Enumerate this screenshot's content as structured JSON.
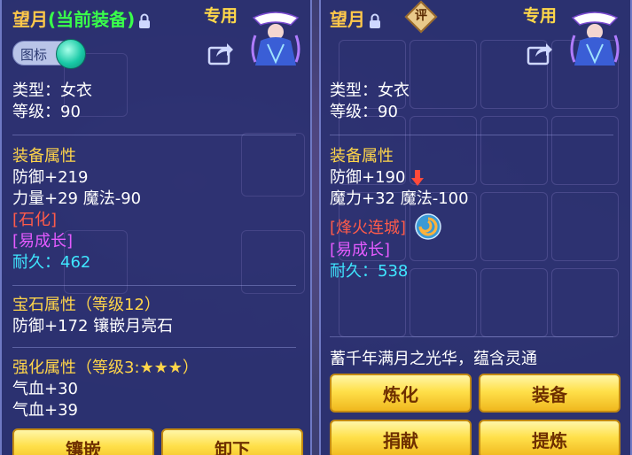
{
  "left_panel": {
    "name": "望月",
    "equipped_tag": "(当前装备)",
    "special_badge": "专用",
    "toggle_label": "图标",
    "type_line": "类型：女衣",
    "level_line": "等级：90",
    "attr_header": "装备属性",
    "attr_lines": [
      "防御+219",
      "力量+29 魔法-90"
    ],
    "tag_red": "[石化]",
    "tag_pink": "[易成长]",
    "durability_label": "耐久：",
    "durability_value": "462",
    "gem_header": "宝石属性（等级12）",
    "gem_line": "防御+172 镶嵌月亮石",
    "enhance_header": "强化属性（等级3:★★★）",
    "enhance_lines": [
      "气血+30",
      "气血+39"
    ],
    "buttons": {
      "inlay": "镶嵌",
      "unequip": "卸下"
    }
  },
  "right_panel": {
    "name": "望月",
    "rate_badge": "评",
    "special_badge": "专用",
    "type_line": "类型：女衣",
    "level_line": "等级：90",
    "attr_header": "装备属性",
    "attr_line_1": "防御+190",
    "attr_line_2": "魔力+32 魔法-100",
    "tag_red": "[烽火连城]",
    "tag_pink": "[易成长]",
    "durability_label": "耐久：",
    "durability_value": "538",
    "description": "蓄千年满月之光华，蕴含灵通",
    "buttons": {
      "refine": "炼化",
      "equip": "装备",
      "donate": "捐献",
      "extract": "提炼"
    }
  },
  "colors": {
    "panel": "#2a3070",
    "gold_title": "#ffc84a",
    "green_tag": "#39ff4a",
    "red_tag": "#ff5b4a",
    "pink_tag": "#e45bff",
    "cyan_value": "#3fe6ff",
    "button_gold": "#ffe04a"
  },
  "icons": [
    "lock-icon",
    "share-icon",
    "portrait-icon",
    "toggle-knob",
    "down-arrow-icon",
    "swirl-skill-icon",
    "rate-badge-icon"
  ]
}
